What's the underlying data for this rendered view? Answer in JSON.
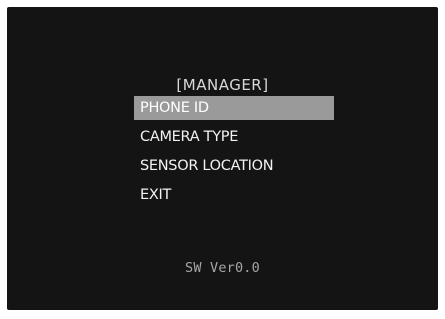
{
  "menu": {
    "title": "[MANAGER]",
    "items": [
      {
        "label": "PHONE ID",
        "selected": true
      },
      {
        "label": "CAMERA TYPE",
        "selected": false
      },
      {
        "label": "SENSOR LOCATION",
        "selected": false
      },
      {
        "label": "EXIT",
        "selected": false
      }
    ]
  },
  "footer": {
    "version": "SW Ver0.0"
  },
  "colors": {
    "screen_background": "#141414",
    "highlight": "#9a9a9a",
    "text": "#f2f2f2",
    "version_text": "#a6a6a6"
  }
}
